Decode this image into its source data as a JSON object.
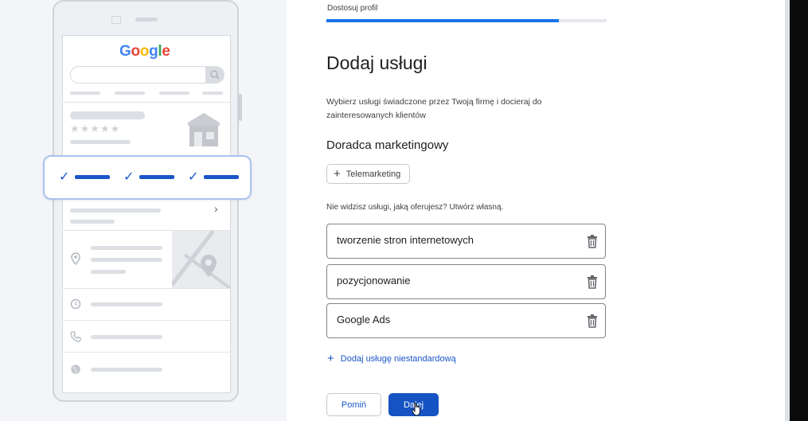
{
  "header": {
    "progress_label": "Dostosuj profil",
    "progress_fraction": 0.83
  },
  "page": {
    "title": "Dodaj usługi",
    "description": "Wybierz usługi świadczone przez Twoją firmę i docieraj do zainteresowanych klientów",
    "category": "Doradca marketingowy"
  },
  "suggested_services": [
    {
      "label": "Telemarketing",
      "icon": "plus-icon"
    }
  ],
  "prompt": "Nie widzisz usługi, jaką oferujesz? Utwórz własną.",
  "custom_services": [
    {
      "value": "tworzenie stron internetowych",
      "icon": "trash-icon"
    },
    {
      "value": "pozycjonowanie",
      "icon": "trash-icon"
    },
    {
      "value": "Google Ads",
      "icon": "trash-icon"
    }
  ],
  "add_custom_label": "Dodaj usługę niestandardową",
  "buttons": {
    "skip": "Pomiń",
    "next": "Dalej"
  },
  "illustration": {
    "logo_text": "Google",
    "stars": "★★★★★"
  },
  "colors": {
    "primary": "#1a73e8",
    "button_primary": "#1553c2",
    "link": "#1a56c8"
  }
}
